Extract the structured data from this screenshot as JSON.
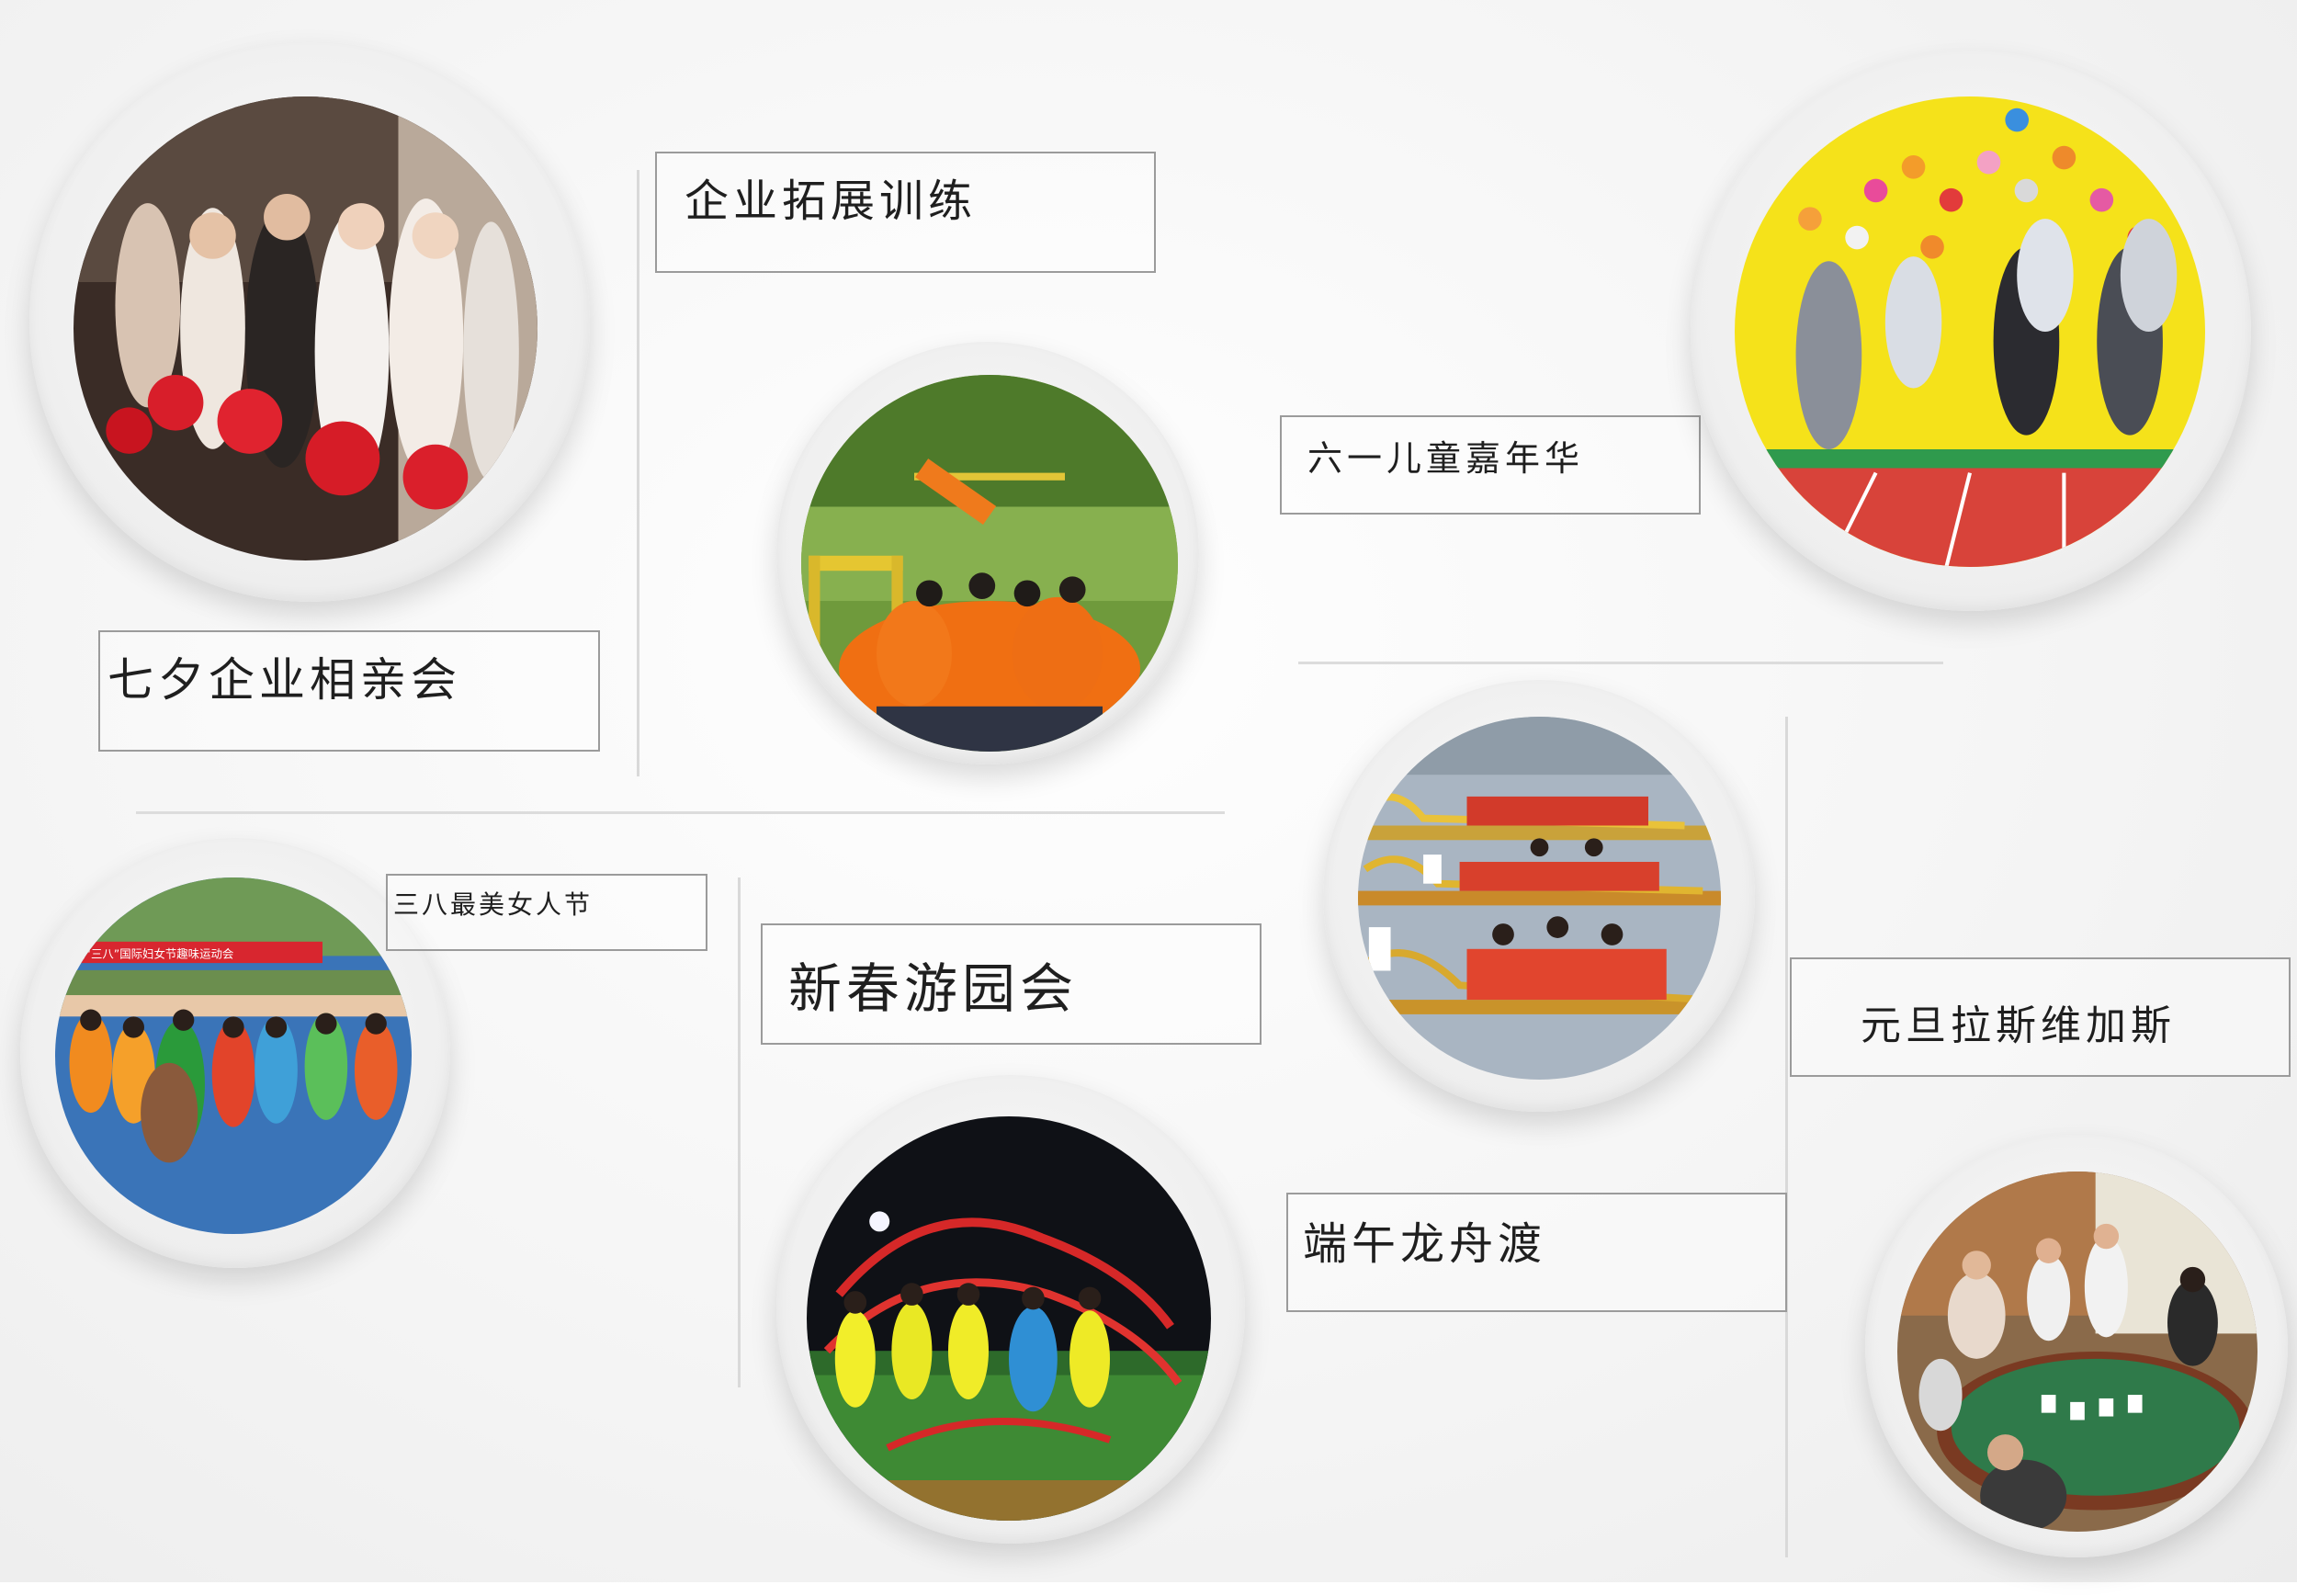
{
  "activities": [
    {
      "id": "qixi",
      "label": "七夕企业相亲会"
    },
    {
      "id": "tuozhan",
      "label": "企业拓展训练"
    },
    {
      "id": "liuyi",
      "label": "六一儿童嘉年华"
    },
    {
      "id": "sanba",
      "label": "三八最美女人节"
    },
    {
      "id": "xinchun",
      "label": "新春游园会"
    },
    {
      "id": "duanwu",
      "label": "端午龙舟渡"
    },
    {
      "id": "yuandan",
      "label": "元旦拉斯维加斯"
    }
  ],
  "photos": {
    "sanba_banner": "庆祝“三八”国际妇女节趣味运动会"
  },
  "colors": {
    "background": "#f2f2f2",
    "frame": "#ededed",
    "divider": "#d9d9d9",
    "label_border": "#9b9b9b"
  }
}
